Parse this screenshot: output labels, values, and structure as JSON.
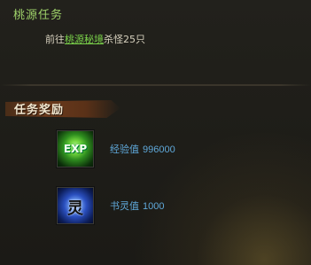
{
  "quest": {
    "title": "桃源任务",
    "desc_prefix": "前往",
    "desc_link": "桃源秘境",
    "desc_suffix": "杀怪25只"
  },
  "rewards_header": "任务奖励",
  "rewards": [
    {
      "icon": "exp-orb-icon",
      "icon_text": "EXP",
      "name": "经验值",
      "value": "996000"
    },
    {
      "icon": "spirit-orb-icon",
      "icon_text": "灵",
      "name": "书灵值",
      "value": "1000"
    }
  ],
  "colors": {
    "title": "#9fd26a",
    "link": "#7ad14a",
    "reward_text": "#5fa8d9"
  }
}
